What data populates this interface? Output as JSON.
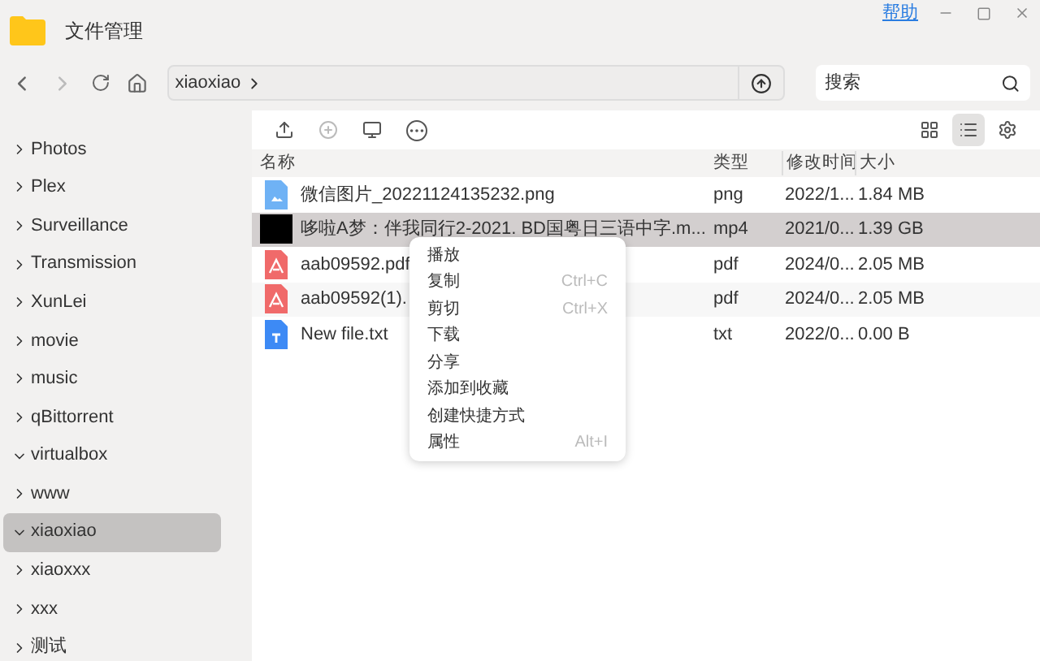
{
  "window": {
    "title": "文件管理",
    "help_link": "帮助"
  },
  "address_bar": {
    "path": "xiaoxiao"
  },
  "search": {
    "placeholder": "搜索"
  },
  "sidebar": {
    "items": [
      {
        "label": "Photos",
        "expanded": false,
        "selected": false
      },
      {
        "label": "Plex",
        "expanded": false,
        "selected": false
      },
      {
        "label": "Surveillance",
        "expanded": false,
        "selected": false
      },
      {
        "label": "Transmission",
        "expanded": false,
        "selected": false
      },
      {
        "label": "XunLei",
        "expanded": false,
        "selected": false
      },
      {
        "label": "movie",
        "expanded": false,
        "selected": false
      },
      {
        "label": "music",
        "expanded": false,
        "selected": false
      },
      {
        "label": "qBittorrent",
        "expanded": false,
        "selected": false
      },
      {
        "label": "virtualbox",
        "expanded": true,
        "selected": false
      },
      {
        "label": "www",
        "expanded": false,
        "selected": false
      },
      {
        "label": "xiaoxiao",
        "expanded": true,
        "selected": true
      },
      {
        "label": "xiaoxxx",
        "expanded": false,
        "selected": false
      },
      {
        "label": "xxx",
        "expanded": false,
        "selected": false
      },
      {
        "label": "测试",
        "expanded": false,
        "selected": false
      }
    ]
  },
  "view_mode": {
    "list_selected": true
  },
  "table": {
    "columns": [
      "名称",
      "类型",
      "修改时间",
      "大小"
    ],
    "rows": [
      {
        "kind": "image",
        "name": "微信图片_20221124135232.png",
        "type": "png",
        "modified": "2022/1...",
        "size": "1.84 MB",
        "selected": false
      },
      {
        "kind": "video",
        "name": "哆啦A梦：伴我同行2-2021. BD国粤日三语中字.m...",
        "type": "mp4",
        "modified": "2021/0...",
        "size": "1.39 GB",
        "selected": true
      },
      {
        "kind": "pdf",
        "name": "aab09592.pdf",
        "type": "pdf",
        "modified": "2024/0...",
        "size": "2.05 MB",
        "selected": false
      },
      {
        "kind": "pdf",
        "name": "aab09592(1).",
        "type": "pdf",
        "modified": "2024/0...",
        "size": "2.05 MB",
        "selected": false
      },
      {
        "kind": "text",
        "name": "New file.txt",
        "type": "txt",
        "modified": "2022/0...",
        "size": "0.00 B",
        "selected": false
      }
    ]
  },
  "context_menu": {
    "items": [
      {
        "label": "播放"
      },
      {
        "label": "复制",
        "shortcut": "Ctrl+C"
      },
      {
        "label": "剪切",
        "shortcut": "Ctrl+X"
      },
      {
        "label": "下载"
      },
      {
        "label": "分享"
      },
      {
        "label": "添加到收藏"
      },
      {
        "label": "创建快捷方式"
      },
      {
        "label": "属性",
        "shortcut": "Alt+I"
      }
    ]
  }
}
